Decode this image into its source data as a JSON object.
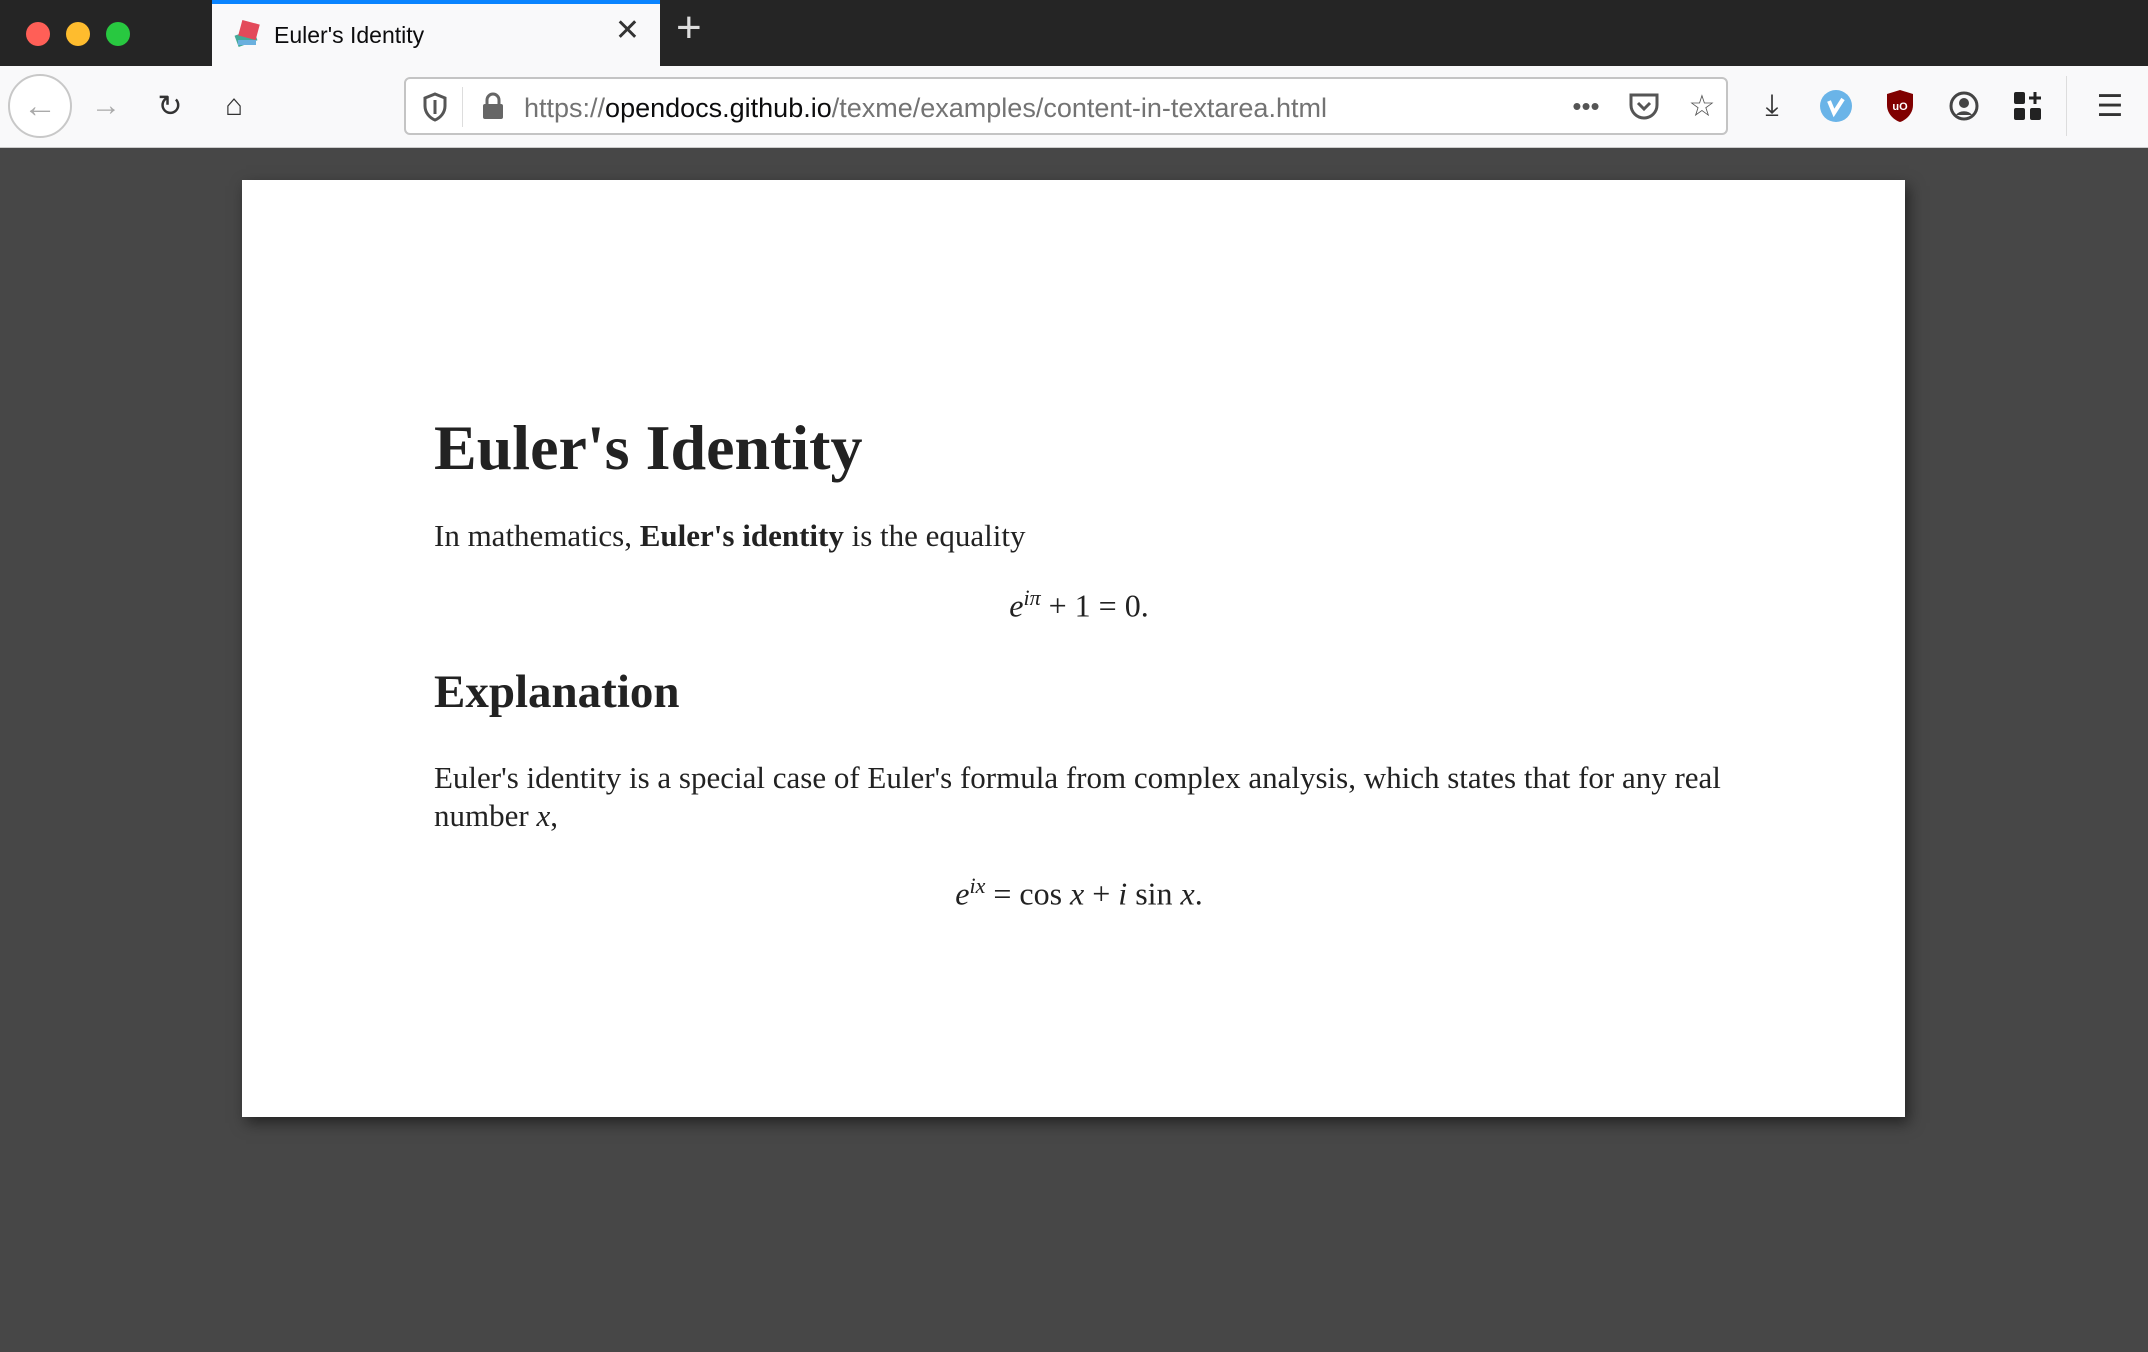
{
  "window": {
    "traffic_lights": {
      "close": "#ff5f57",
      "minimize": "#febc2e",
      "maximize": "#28c840"
    }
  },
  "tab": {
    "title": "Euler's Identity",
    "close_glyph": "✕",
    "new_tab_glyph": "+"
  },
  "toolbar": {
    "url_scheme": "https://",
    "url_host": "opendocs.github.io",
    "url_path": "/texme/examples/content-in-textarea.html"
  },
  "document": {
    "title": "Euler's Identity",
    "intro_before": "In mathematics, ",
    "intro_bold": "Euler's identity",
    "intro_after": " is the equality",
    "eq1": {
      "base": "e",
      "exp": "iπ",
      "rest": " + 1 = 0."
    },
    "heading": "Explanation",
    "para": "Euler's identity is a special case of Euler's formula from complex analysis, which states that for any real number ",
    "para_var": "x",
    "para_end": ",",
    "eq2": {
      "base": "e",
      "exp": "ix",
      "rest1": " = cos ",
      "x1": "x",
      "rest2": " + ",
      "i": "i",
      "rest3": " sin ",
      "x2": "x",
      "end": "."
    }
  }
}
